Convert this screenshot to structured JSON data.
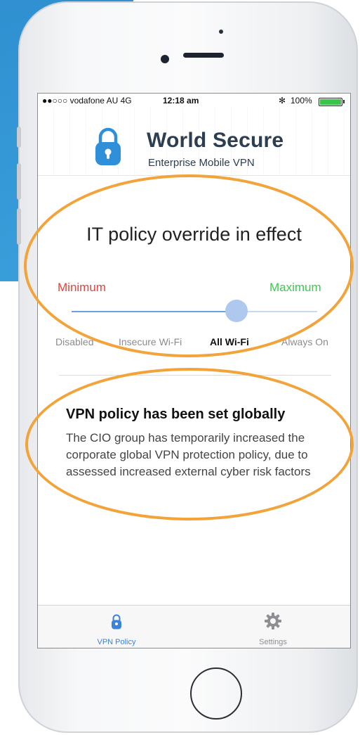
{
  "status_bar": {
    "carrier": "●●○○○ vodafone AU  4G",
    "time": "12:18 am",
    "bluetooth": "✻",
    "battery": "100%"
  },
  "header": {
    "title": "World Secure",
    "subtitle": "Enterprise Mobile VPN"
  },
  "policy": {
    "heading": "IT policy override in effect",
    "min_label": "Minimum",
    "max_label": "Maximum",
    "min_color": "#e4433b",
    "max_color": "#3cc94f",
    "slider_level": 0.67,
    "stops": [
      {
        "label": "Disabled",
        "selected": false
      },
      {
        "label": "Insecure Wi-Fi",
        "selected": false
      },
      {
        "label": "All Wi-Fi",
        "selected": true
      },
      {
        "label": "Always On",
        "selected": false
      }
    ]
  },
  "message": {
    "title": "VPN policy has been set globally",
    "body": "The CIO group has temporarily increased the corporate global VPN protection policy, due to assessed increased external cyber risk factors"
  },
  "tabs": [
    {
      "label": "VPN Policy",
      "icon": "lock-icon",
      "active": true,
      "color": "#3b82d9"
    },
    {
      "label": "Settings",
      "icon": "gear-icon",
      "active": false,
      "color": "#8e8e93"
    }
  ],
  "annotation_color": "#f2a33a"
}
